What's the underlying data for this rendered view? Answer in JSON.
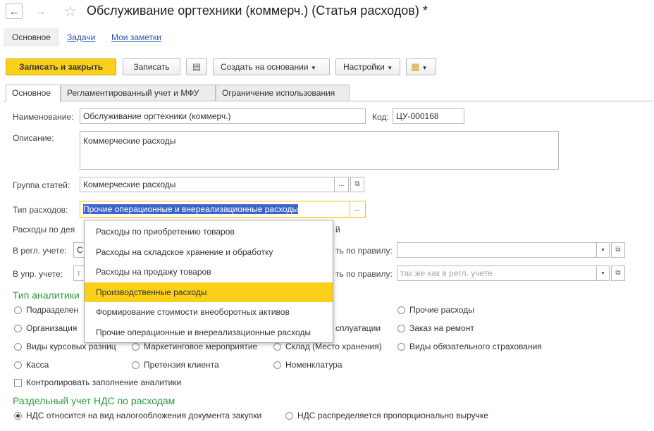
{
  "window": {
    "title": "Обслуживание оргтехники (коммерч.) (Статья расходов) *"
  },
  "navtabs": [
    {
      "label": "Основное"
    },
    {
      "label": "Задачи"
    },
    {
      "label": "Мои заметки"
    }
  ],
  "toolbar": {
    "save_close": "Записать и закрыть",
    "save": "Записать",
    "create_based": "Создать на основании",
    "settings": "Настройки"
  },
  "tabs": [
    {
      "label": "Основное"
    },
    {
      "label": "Регламентированный учет и МФУ"
    },
    {
      "label": "Ограничение использования"
    }
  ],
  "form": {
    "name_label": "Наименование:",
    "name_value": "Обслуживание оргтехники (коммерч.)",
    "code_label": "Код:",
    "code_value": "ЦУ-000168",
    "desc_label": "Описание:",
    "desc_value": "Коммерческие расходы",
    "group_label": "Группа статей:",
    "group_value": "Коммерческие расходы",
    "type_label": "Тип расходов:",
    "type_value": "Прочие операционные и внереализационные расходы",
    "activity_label": "Расходы по дея",
    "activity_suffix": "й",
    "regl_label": "В регл. учете:",
    "regl_value": "С",
    "rule_label1": "ть по правилу:",
    "upr_label": "В упр. учете:",
    "upr_value": "т",
    "rule_label2": "ть по правилу:",
    "rule_placeholder2": "так же как в регл. учете"
  },
  "analytics": {
    "title": "Тип аналитики",
    "options": [
      {
        "label": "Подразделен"
      },
      {
        "label": "Организация"
      },
      {
        "label": "Виды курсовых разниц"
      },
      {
        "label": "Касса"
      },
      {
        "label": "Маркетинговое мероприятие"
      },
      {
        "label": "Претензия клиента"
      },
      {
        "label": "сплуатации"
      },
      {
        "label": "Склад (Место хранения)"
      },
      {
        "label": "Номенклатура"
      },
      {
        "label": "Прочие расходы"
      },
      {
        "label": "Заказ на ремонт"
      },
      {
        "label": "Виды обязательного страхования"
      }
    ],
    "control_check": "Контролировать заполнение аналитики"
  },
  "vat": {
    "title": "Раздельный учет НДС по расходам",
    "option1": "НДС относится на вид налогообложения документа закупки",
    "option2": "НДС распределяется пропорционально выручке"
  },
  "dropdown": {
    "items": [
      {
        "label": "Расходы по приобретению товаров"
      },
      {
        "label": "Расходы на складское хранение и обработку"
      },
      {
        "label": "Расходы на продажу товаров"
      },
      {
        "label": "Производственные расходы"
      },
      {
        "label": "Формирование стоимости внеоборотных активов"
      },
      {
        "label": "Прочие операционные и внереализационные расходы"
      }
    ],
    "selected_index": 3
  },
  "colors": {
    "accent": "#fbd01b",
    "link": "#2a55b0",
    "section": "#2d9a3a",
    "selection": "#3a64c8"
  }
}
